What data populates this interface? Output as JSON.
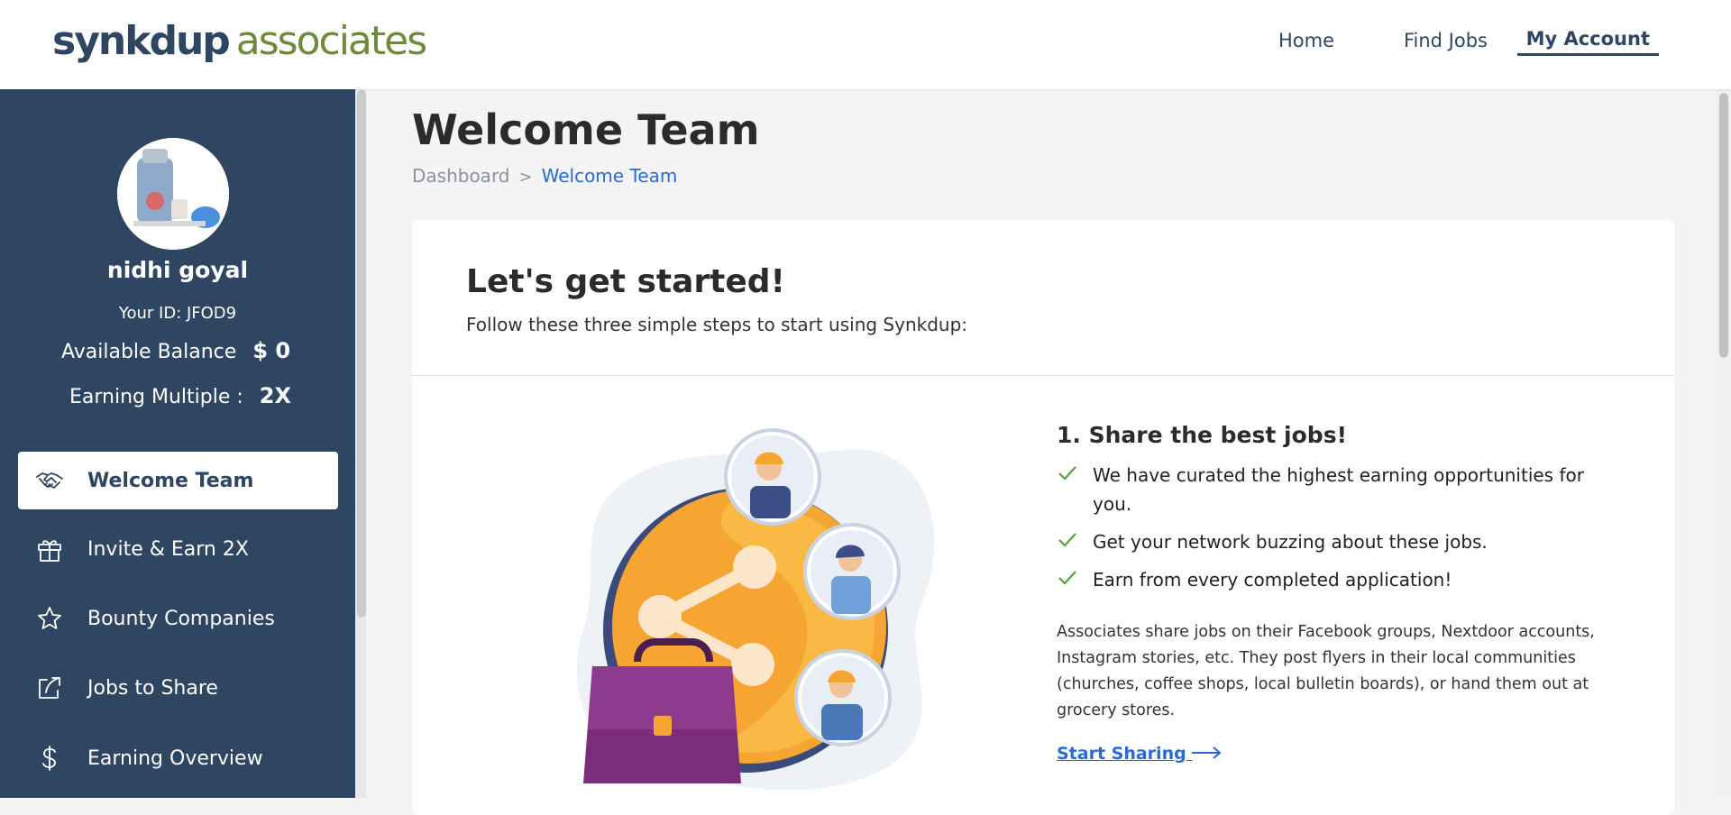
{
  "brand": {
    "logo_part1": "synkdup",
    "logo_part2": "associates"
  },
  "nav": {
    "home": "Home",
    "find_jobs": "Find Jobs",
    "my_account": "My Account"
  },
  "profile": {
    "name": "nidhi goyal",
    "id_text": "Your ID: JFOD9",
    "balance_label": "Available Balance",
    "balance_value": "$ 0",
    "multiple_label": "Earning Multiple :",
    "multiple_value": "2X"
  },
  "sidebar": {
    "items": [
      {
        "label": "Welcome Team",
        "icon": "handshake-icon",
        "active": true
      },
      {
        "label": "Invite & Earn 2X",
        "icon": "gift-icon",
        "active": false
      },
      {
        "label": "Bounty Companies",
        "icon": "star-icon",
        "active": false
      },
      {
        "label": "Jobs to Share",
        "icon": "share-icon",
        "active": false
      },
      {
        "label": "Earning Overview",
        "icon": "dollar-icon",
        "active": false
      }
    ]
  },
  "page": {
    "title": "Welcome Team",
    "breadcrumb": {
      "parent": "Dashboard",
      "current": "Welcome Team"
    }
  },
  "card": {
    "title": "Let's get started!",
    "subtitle": "Follow these three simple steps to start using Synkdup:",
    "step1": {
      "title": "1. Share the best jobs!",
      "bullets": [
        "We have curated the highest earning opportunities for you.",
        "Get your network buzzing about these jobs.",
        "Earn from every completed application!"
      ],
      "description": "Associates share jobs on their Facebook groups, Nextdoor accounts, Instagram stories, etc. They post flyers in their local communities (churches, coffee shops, local bulletin boards), or hand them out at grocery stores.",
      "link": "Start Sharing"
    }
  },
  "colors": {
    "sidebar": "#2f4663",
    "accent": "#2a6ad1",
    "brand_green": "#6d8b3a",
    "check": "#5aa03c"
  }
}
